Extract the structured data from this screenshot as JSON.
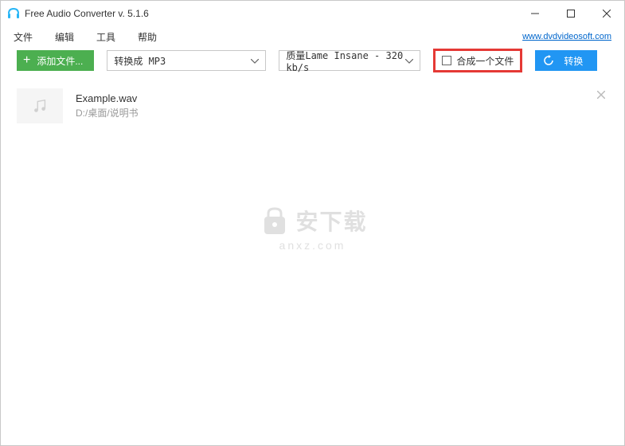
{
  "titlebar": {
    "title": "Free Audio Converter v. 5.1.6"
  },
  "menu": {
    "file": "文件",
    "edit": "编辑",
    "tools": "工具",
    "help": "帮助",
    "site_link": "www.dvdvideosoft.com"
  },
  "toolbar": {
    "add_label": "添加文件...",
    "format_selected": "转换成 MP3",
    "quality_selected": "质量Lame Insane - 320 kb/s",
    "merge_label": "合成一个文件",
    "convert_label": "转换"
  },
  "files": [
    {
      "name": "Example.wav",
      "path": "D:/桌面/说明书"
    }
  ],
  "watermark": {
    "text": "安下载",
    "sub": "anxz.com"
  }
}
